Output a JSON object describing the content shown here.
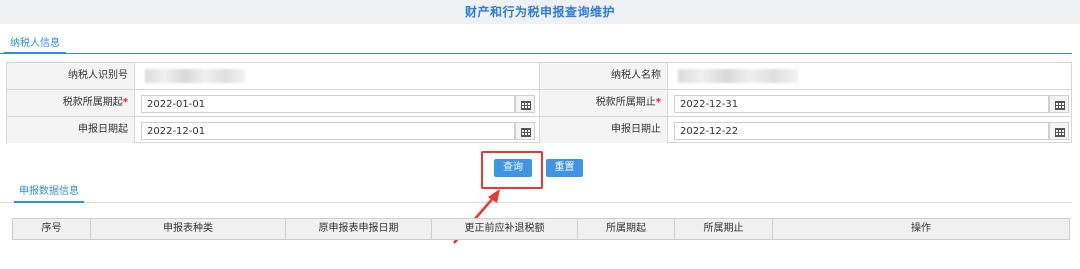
{
  "header": {
    "title": "财产和行为税申报查询维护"
  },
  "taxpayer_tab": {
    "label": "纳税人信息"
  },
  "form": {
    "taxpayer_id_label": "纳税人识别号",
    "taxpayer_name_label": "纳税人名称",
    "period_start_label": "税款所属期起",
    "period_end_label": "税款所属期止",
    "period_start_value": "2022-01-01",
    "period_end_value": "2022-12-31",
    "filing_start_label": "申报日期起",
    "filing_end_label": "申报日期止",
    "filing_start_value": "2022-12-01",
    "filing_end_value": "2022-12-22",
    "required_mark": "*"
  },
  "buttons": {
    "query": "查询",
    "reset": "重置"
  },
  "data_tab": {
    "label": "申报数据信息"
  },
  "table": {
    "columns": [
      "序号",
      "申报表种类",
      "原申报表申报日期",
      "更正前应补退税额",
      "所属期起",
      "所属期止",
      "操作"
    ]
  },
  "colors": {
    "accent": "#3f95e2",
    "title": "#2e7bd1",
    "highlight": "#e53a36",
    "required": "#e02020"
  },
  "icons": {
    "calendar": "calendar-icon",
    "arrow": "red-arrow-annotation"
  }
}
